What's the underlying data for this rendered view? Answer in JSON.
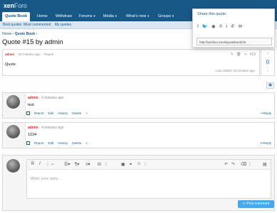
{
  "header": {
    "logo_main": "xen",
    "logo_rest": "Foro"
  },
  "nav": {
    "tabs": [
      {
        "label": "Quote Book",
        "active": true
      },
      {
        "label": "Home"
      },
      {
        "label": "Withdraw"
      },
      {
        "label": "Forums",
        "dropdown": true
      },
      {
        "label": "Media",
        "dropdown": true
      },
      {
        "label": "What's new",
        "dropdown": true
      },
      {
        "label": "Groups",
        "dropdown": true
      }
    ],
    "sub_items": [
      "Best quotes",
      "Most commented",
      "My quotes"
    ]
  },
  "breadcrumb": {
    "home": "Home",
    "sep": "›",
    "section": "Quote Book",
    "sep2": "›"
  },
  "page_title": "Quote #15 by admin",
  "quote": {
    "author": "admin",
    "time": "32 minutes ago",
    "report": "Report",
    "text": "Quote",
    "edited": "Last edited: 32 minutes ago",
    "number": "#15",
    "votes": "0"
  },
  "share": {
    "title": "Share this quote",
    "icons": [
      "facebook-icon",
      "twitter-icon",
      "reddit-icon",
      "pinterest-icon",
      "tumblr-icon",
      "whatsapp-icon",
      "email-icon"
    ],
    "url": "http://xenforo.local/quotebook/15"
  },
  "comments": [
    {
      "author": "admin",
      "time": "4 minutes ago",
      "text": "test",
      "actions": [
        "Report",
        "Edit",
        "History",
        "Delete"
      ],
      "reply": "Reply"
    },
    {
      "author": "admin",
      "time": "4 minutes ago",
      "text": "1234",
      "actions": [
        "Report",
        "Edit",
        "History",
        "Delete"
      ],
      "reply": "Reply"
    }
  ],
  "editor": {
    "placeholder": "Write your reply...",
    "post_button": "Post comment"
  },
  "colors": {
    "brand": "#185886",
    "accent": "#47a7eb",
    "author": "#c42e2e"
  }
}
